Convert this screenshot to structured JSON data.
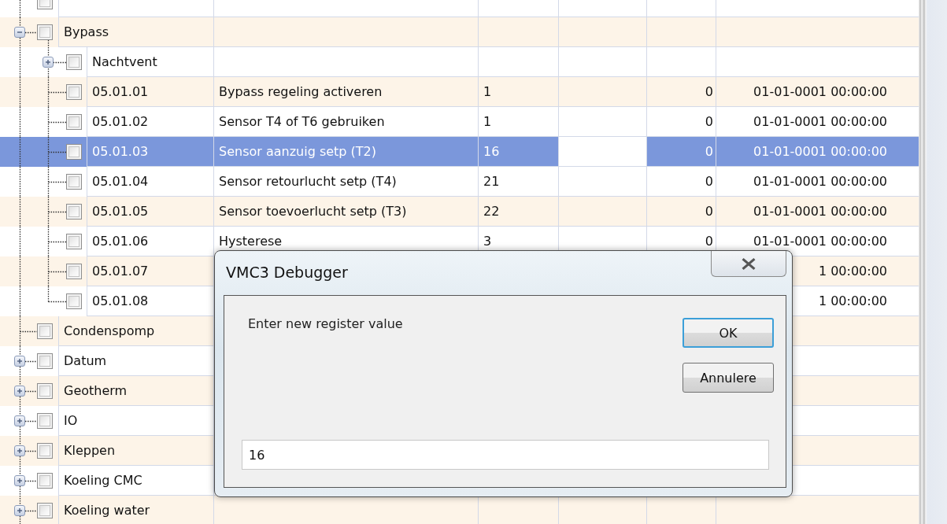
{
  "partial_row": {
    "checked": false
  },
  "tree": [
    {
      "name": "Bypass",
      "expanded": true,
      "checked": false,
      "selected": false,
      "children": [
        {
          "name": "Nachtvent",
          "expanded": false,
          "checked": false,
          "selected": false
        },
        {
          "name": "05.01.01",
          "checked": false,
          "selected": false,
          "column_2": "Bypass regeling activeren",
          "column_3": "1",
          "column_5": "0",
          "column_6": "01-01-0001 00:00:00"
        },
        {
          "name": "05.01.02",
          "checked": false,
          "selected": false,
          "column_2": "Sensor T4 of T6 gebruiken",
          "column_3": "1",
          "column_5": "0",
          "column_6": "01-01-0001 00:00:00"
        },
        {
          "name": "05.01.03",
          "checked": false,
          "selected": true,
          "column_2": "Sensor aanzuig setp (T2)",
          "column_3": "16",
          "column_5": "0",
          "column_6": "01-01-0001 00:00:00"
        },
        {
          "name": "05.01.04",
          "checked": false,
          "selected": false,
          "column_2": "Sensor retourlucht setp (T4)",
          "column_3": "21",
          "column_5": "0",
          "column_6": "01-01-0001 00:00:00"
        },
        {
          "name": "05.01.05",
          "checked": false,
          "selected": false,
          "column_2": "Sensor toevoerlucht setp (T3)",
          "column_3": "22",
          "column_5": "0",
          "column_6": "01-01-0001 00:00:00"
        },
        {
          "name": "05.01.06",
          "checked": false,
          "selected": false,
          "column_2": "Hysterese",
          "column_3": "3",
          "column_5": "0",
          "column_6": "01-01-0001 00:00:00"
        },
        {
          "name": "05.01.07",
          "checked": false,
          "selected": false,
          "column_6": "1 00:00:00"
        },
        {
          "name": "05.01.08",
          "checked": false,
          "selected": false,
          "column_6": "1 00:00:00"
        }
      ]
    },
    {
      "name": "Condenspomp",
      "checked": false,
      "selected": false
    },
    {
      "name": "Datum",
      "expanded": false,
      "checked": false,
      "selected": false
    },
    {
      "name": "Geotherm",
      "expanded": false,
      "checked": false,
      "selected": false
    },
    {
      "name": "IO",
      "expanded": false,
      "checked": false,
      "selected": false
    },
    {
      "name": "Kleppen",
      "expanded": false,
      "checked": false,
      "selected": false
    },
    {
      "name": "Koeling CMC",
      "expanded": false,
      "checked": false,
      "selected": false
    },
    {
      "name": "Koeling water",
      "expanded": false,
      "checked": false,
      "selected": false
    }
  ],
  "dialog": {
    "title": "VMC3 Debugger",
    "prompt": "Enter new register value",
    "buttons": [
      {
        "label": "OK",
        "default": true
      },
      {
        "label": "Annulere",
        "default": false
      }
    ],
    "input": {
      "value": "16"
    }
  }
}
